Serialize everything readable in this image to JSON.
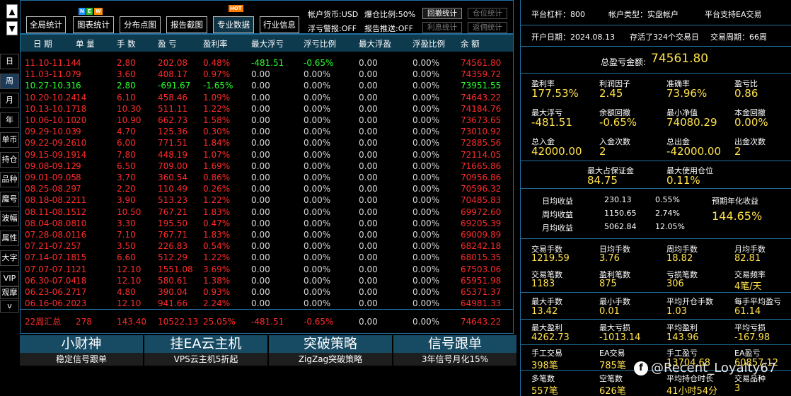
{
  "left_scroll": {
    "up": "▲",
    "down": "▼"
  },
  "left_buttons": [
    "日",
    "周",
    "月",
    "年",
    "单币",
    "持仓",
    "品种",
    "魔号",
    "波幅",
    "属性",
    "大字",
    "VIP",
    "观摩",
    "v"
  ],
  "left_active_index": 1,
  "toolbar": {
    "buttons": [
      {
        "label": "全局统计",
        "active": false
      },
      {
        "label": "图表统计",
        "active": false,
        "badge": "NEW"
      },
      {
        "label": "分布点图",
        "active": false
      },
      {
        "label": "报告截图",
        "active": false
      },
      {
        "label": "专业数据",
        "active": true,
        "badge": "HOT"
      },
      {
        "label": "行业信息",
        "active": false
      }
    ],
    "info": [
      {
        "text": "帐户货币:USD"
      },
      {
        "text": "爆仓比例:50%"
      },
      {
        "text": "浮亏警报:OFF"
      },
      {
        "text": "报告推送:OFF"
      }
    ],
    "small_buttons": [
      {
        "label": "回撤统计",
        "enabled": true
      },
      {
        "label": "仓位统计",
        "enabled": false
      },
      {
        "label": "利息统计",
        "enabled": false
      },
      {
        "label": "返佣统计",
        "enabled": false
      }
    ],
    "badge_colors": {
      "NEW_n": "#1e90ff",
      "NEW_e": "#2bbf2b",
      "NEW_w": "#ff8c00",
      "HOT": "#ff7a00"
    }
  },
  "table": {
    "headers": [
      "日 期",
      "单 量",
      "手 数",
      "盈 亏",
      "盈利率",
      "最大浮亏",
      "浮亏比例",
      "最大浮盈",
      "浮盈比例",
      "余 额"
    ],
    "rows": [
      [
        "11.10-11.14",
        "4",
        "2.80",
        "202.08",
        "0.48%",
        "-481.51",
        "-0.65%",
        "0.00",
        "0.00%",
        "74561.80",
        "up"
      ],
      [
        "11.03-11.07",
        "9",
        "3.60",
        "408.17",
        "0.97%",
        "0.00",
        "0.00%",
        "0.00",
        "0.00%",
        "74359.72",
        "up"
      ],
      [
        "10.27-10.31",
        "6",
        "2.80",
        "-691.67",
        "-1.65%",
        "0.00",
        "0.00%",
        "0.00",
        "0.00%",
        "73951.55",
        "down"
      ],
      [
        "10.20-10.24",
        "14",
        "6.10",
        "458.46",
        "1.09%",
        "0.00",
        "0.00%",
        "0.00",
        "0.00%",
        "74643.22",
        "up"
      ],
      [
        "10.13-10.17",
        "18",
        "10.30",
        "511.11",
        "1.22%",
        "0.00",
        "0.00%",
        "0.00",
        "0.00%",
        "74184.76",
        "up"
      ],
      [
        "10.06-10.10",
        "20",
        "10.90",
        "662.73",
        "1.58%",
        "0.00",
        "0.00%",
        "0.00",
        "0.00%",
        "73673.65",
        "up"
      ],
      [
        "09.29-10.03",
        "9",
        "4.70",
        "125.36",
        "0.30%",
        "0.00",
        "0.00%",
        "0.00",
        "0.00%",
        "73010.92",
        "up"
      ],
      [
        "09.22-09.26",
        "10",
        "6.00",
        "771.51",
        "1.84%",
        "0.00",
        "0.00%",
        "0.00",
        "0.00%",
        "72885.56",
        "up"
      ],
      [
        "09.15-09.19",
        "14",
        "7.80",
        "448.19",
        "1.07%",
        "0.00",
        "0.00%",
        "0.00",
        "0.00%",
        "72114.05",
        "up"
      ],
      [
        "09.08-09.12",
        "9",
        "6.50",
        "709.00",
        "1.69%",
        "0.00",
        "0.00%",
        "0.00",
        "0.00%",
        "71665.86",
        "up"
      ],
      [
        "09.01-09.05",
        "8",
        "3.70",
        "360.54",
        "0.86%",
        "0.00",
        "0.00%",
        "0.00",
        "0.00%",
        "70956.86",
        "up"
      ],
      [
        "08.25-08.29",
        "7",
        "2.20",
        "110.49",
        "0.26%",
        "0.00",
        "0.00%",
        "0.00",
        "0.00%",
        "70596.32",
        "up"
      ],
      [
        "08.18-08.22",
        "11",
        "3.90",
        "513.23",
        "1.22%",
        "0.00",
        "0.00%",
        "0.00",
        "0.00%",
        "70485.83",
        "up"
      ],
      [
        "08.11-08.15",
        "12",
        "10.50",
        "767.21",
        "1.83%",
        "0.00",
        "0.00%",
        "0.00",
        "0.00%",
        "69972.60",
        "up"
      ],
      [
        "08.04-08.08",
        "10",
        "3.30",
        "195.50",
        "0.47%",
        "0.00",
        "0.00%",
        "0.00",
        "0.00%",
        "69205.39",
        "up"
      ],
      [
        "07.28-08.01",
        "16",
        "7.10",
        "767.71",
        "1.83%",
        "0.00",
        "0.00%",
        "0.00",
        "0.00%",
        "69009.89",
        "up"
      ],
      [
        "07.21-07.25",
        "7",
        "3.50",
        "226.83",
        "0.54%",
        "0.00",
        "0.00%",
        "0.00",
        "0.00%",
        "68242.18",
        "up"
      ],
      [
        "07.14-07.18",
        "15",
        "6.60",
        "512.29",
        "1.22%",
        "0.00",
        "0.00%",
        "0.00",
        "0.00%",
        "68015.35",
        "up"
      ],
      [
        "07.07-07.11",
        "21",
        "12.10",
        "1551.08",
        "3.69%",
        "0.00",
        "0.00%",
        "0.00",
        "0.00%",
        "67503.06",
        "up"
      ],
      [
        "06.30-07.04",
        "18",
        "12.10",
        "580.61",
        "1.38%",
        "0.00",
        "0.00%",
        "0.00",
        "0.00%",
        "65951.98",
        "up"
      ],
      [
        "06.23-06.27",
        "17",
        "4.80",
        "390.04",
        "0.93%",
        "0.00",
        "0.00%",
        "0.00",
        "0.00%",
        "65371.37",
        "up"
      ],
      [
        "06.16-06.20",
        "23",
        "12.10",
        "941.66",
        "2.24%",
        "0.00",
        "0.00%",
        "0.00",
        "0.00%",
        "64981.33",
        "up"
      ]
    ],
    "summary": [
      "22周汇总",
      "278",
      "143.40",
      "10522.13",
      "25.05%",
      "-481.51",
      "-0.65%",
      "0.00",
      "0.00%",
      "74643.22"
    ]
  },
  "banners": [
    {
      "title": "小财神",
      "sub": "稳定信号跟单"
    },
    {
      "title": "挂EA云主机",
      "sub": "VPS云主机5折起"
    },
    {
      "title": "突破策略",
      "sub": "ZigZag突破策略"
    },
    {
      "title": "信号跟单",
      "sub": "3年信号月化15%"
    }
  ],
  "panel": {
    "top": [
      "平台杠杆：800",
      "帐户类型：实盘帐户",
      "平台支持EA交易"
    ],
    "top2": [
      "开户日期：2024.08.13",
      "存活了324个交易日",
      "交易周期：66周"
    ],
    "total_label": "总盈亏金额:",
    "total_value": "74561.80",
    "grid1": [
      {
        "label": "盈利率",
        "value": "177.53%"
      },
      {
        "label": "利润因子",
        "value": "2.45"
      },
      {
        "label": "准确率",
        "value": "73.96%"
      },
      {
        "label": "盈亏比",
        "value": "0.86"
      },
      {
        "label": "最大浮亏",
        "value": "-481.51"
      },
      {
        "label": "余额回撤",
        "value": "-0.65%"
      },
      {
        "label": "最小净值",
        "value": "74080.29"
      },
      {
        "label": "本金回撤",
        "value": "0.00%"
      },
      {
        "label": "总入金",
        "value": "42000.00"
      },
      {
        "label": "入金次数",
        "value": "2"
      },
      {
        "label": "总出金",
        "value": "-42000.00"
      },
      {
        "label": "出金次数",
        "value": "2"
      }
    ],
    "margin": [
      {
        "label": "最大占保证金",
        "value": "84.75"
      },
      {
        "label": "最大使用仓位",
        "value": "0.11%"
      }
    ],
    "returns": [
      {
        "label": "日均收益",
        "value": "230.13",
        "pct": "0.55%"
      },
      {
        "label": "周均收益",
        "value": "1150.65",
        "pct": "2.74%"
      },
      {
        "label": "月均收益",
        "value": "5062.84",
        "pct": "12.05%"
      }
    ],
    "annual_label": "预期年化收益",
    "annual_value": "144.65%",
    "grid2": [
      {
        "label": "交易手数",
        "value": "1219.59"
      },
      {
        "label": "日均手数",
        "value": "3.76"
      },
      {
        "label": "周均手数",
        "value": "18.82"
      },
      {
        "label": "月均手数",
        "value": "82.81"
      },
      {
        "label": "交易笔数",
        "value": "1183"
      },
      {
        "label": "盈利笔数",
        "value": "875"
      },
      {
        "label": "亏损笔数",
        "value": "306"
      },
      {
        "label": "交易频率",
        "value": "4笔/天"
      }
    ],
    "grid3": [
      {
        "label": "最大手数",
        "value": "13.42"
      },
      {
        "label": "最小手数",
        "value": "0.01"
      },
      {
        "label": "平均开仓手数",
        "value": "1.03"
      },
      {
        "label": "每手平均盈亏",
        "value": "61.14"
      }
    ],
    "grid4": [
      {
        "label": "最大盈利",
        "value": "4262.73"
      },
      {
        "label": "最大亏损",
        "value": "-1013.14"
      },
      {
        "label": "平均盈利",
        "value": "143.96"
      },
      {
        "label": "平均亏损",
        "value": "-167.98"
      }
    ],
    "grid5": [
      {
        "label": "手工交易",
        "value": "398笔"
      },
      {
        "label": "EA交易",
        "value": "785笔"
      },
      {
        "label": "手工盈亏",
        "value": "13704.68"
      },
      {
        "label": "EA盈亏",
        "value": "60857.12"
      }
    ],
    "grid6": [
      {
        "label": "多笔数",
        "value": "557笔"
      },
      {
        "label": "空笔数",
        "value": "626笔"
      },
      {
        "label": "平均持仓时长",
        "value": "41小时54分"
      },
      {
        "label": "交易品种",
        "value": "3"
      }
    ]
  },
  "watermark": {
    "logo": "f",
    "text": "@Recent_Loyalty67"
  }
}
